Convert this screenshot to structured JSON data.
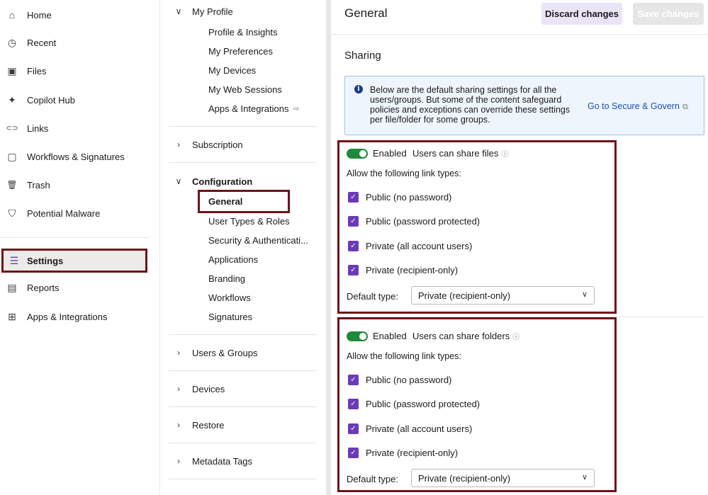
{
  "left_nav": {
    "items": [
      {
        "label": "Home",
        "icon": "home-icon",
        "glyph": "⌂"
      },
      {
        "label": "Recent",
        "icon": "clock-icon",
        "glyph": "◷"
      },
      {
        "label": "Files",
        "icon": "files-icon",
        "glyph": "▣"
      },
      {
        "label": "Copilot Hub",
        "icon": "sparkle-icon",
        "glyph": "✦"
      },
      {
        "label": "Links",
        "icon": "link-icon",
        "glyph": "⊂⊃"
      },
      {
        "label": "Workflows & Signatures",
        "icon": "clipboard-icon",
        "glyph": "▢"
      },
      {
        "label": "Trash",
        "icon": "trash-icon",
        "glyph": "🗑"
      },
      {
        "label": "Potential Malware",
        "icon": "shield-alert-icon",
        "glyph": "⛉"
      },
      {
        "label": "Settings",
        "icon": "sliders-icon",
        "glyph": "☰"
      },
      {
        "label": "Reports",
        "icon": "report-icon",
        "glyph": "▤"
      },
      {
        "label": "Apps & Integrations",
        "icon": "apps-icon",
        "glyph": "⊞"
      }
    ],
    "active": "Settings"
  },
  "settings_nav": {
    "my_profile": {
      "label": "My Profile",
      "items": [
        "Profile & Insights",
        "My Preferences",
        "My Devices",
        "My Web Sessions",
        "Apps & Integrations"
      ]
    },
    "subscription": "Subscription",
    "configuration": {
      "label": "Configuration",
      "items": [
        "General",
        "User Types & Roles",
        "Security & Authenticati...",
        "Applications",
        "Branding",
        "Workflows",
        "Signatures"
      ]
    },
    "users_groups": "Users & Groups",
    "devices": "Devices",
    "restore": "Restore",
    "metadata_tags": "Metadata Tags",
    "active": "General"
  },
  "main": {
    "title": "General",
    "discard_label": "Discard changes",
    "save_label": "Save changes",
    "section": "Sharing",
    "info": {
      "text": "Below are the default sharing settings for all the users/groups. But some of the content safeguard policies and exceptions can override these settings per file/folder for some groups.",
      "link": "Go to Secure & Govern"
    },
    "files": {
      "toggle_label": "Enabled",
      "toggle_on": true,
      "title": "Users can share files",
      "allow_label": "Allow the following link types:",
      "options": [
        {
          "label": "Public (no password)",
          "checked": true
        },
        {
          "label": "Public (password protected)",
          "checked": true
        },
        {
          "label": "Private (all account users)",
          "checked": true
        },
        {
          "label": "Private (recipient-only)",
          "checked": true
        }
      ],
      "default_label": "Default type:",
      "default_value": "Private (recipient-only)"
    },
    "folders": {
      "toggle_label": "Enabled",
      "toggle_on": true,
      "title": "Users can share folders",
      "allow_label": "Allow the following link types:",
      "options": [
        {
          "label": "Public (no password)",
          "checked": true
        },
        {
          "label": "Public (password protected)",
          "checked": true
        },
        {
          "label": "Private (all account users)",
          "checked": true
        },
        {
          "label": "Private (recipient-only)",
          "checked": true
        }
      ],
      "default_label": "Default type:",
      "default_value": "Private (recipient-only)"
    }
  },
  "colors": {
    "accent_purple": "#6a3ab8",
    "toggle_green": "#1f8a3b",
    "highlight_border": "#6f1219",
    "link_blue": "#1a4fbf"
  }
}
